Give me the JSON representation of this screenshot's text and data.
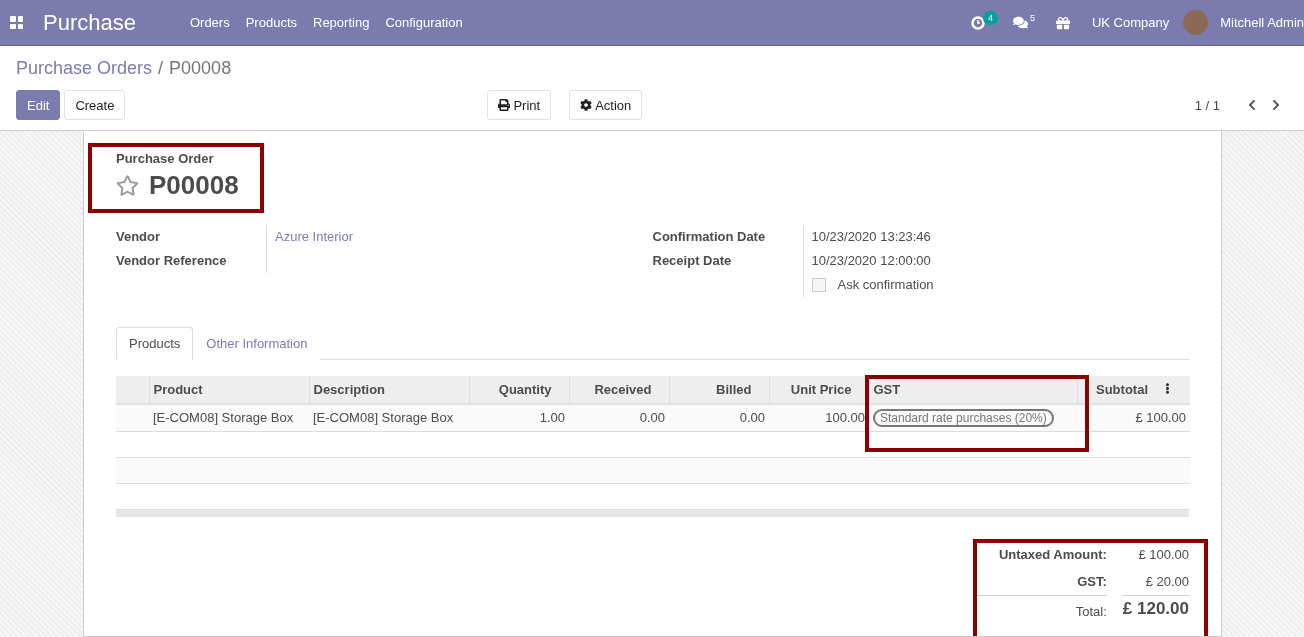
{
  "navbar": {
    "app_title": "Purchase",
    "menu": [
      "Orders",
      "Products",
      "Reporting",
      "Configuration"
    ],
    "activity_count": "4",
    "message_count": "5",
    "company": "UK Company",
    "user": "Mitchell Admin"
  },
  "breadcrumb": {
    "parent": "Purchase Orders",
    "separator": "/",
    "current": "P00008"
  },
  "buttons": [
    {
      "label": "Edit",
      "kind": "primary"
    },
    {
      "label": "Create",
      "kind": "secondary"
    }
  ],
  "actions": [
    {
      "label": "Print",
      "kind": "print"
    },
    {
      "label": "Action",
      "kind": "gear"
    }
  ],
  "pager": "1 / 1",
  "form": {
    "caption": "Purchase Order",
    "name": "P00008",
    "starred": false,
    "left_fields": [
      {
        "label": "Vendor",
        "value": "Azure Interior",
        "kind": "link"
      },
      {
        "label": "Vendor Reference"
      }
    ],
    "right_fields": [
      {
        "label": "Confirmation Date",
        "value": "10/23/2020 13:23:46"
      },
      {
        "label": "Receipt Date",
        "value": "10/23/2020 12:00:00"
      }
    ],
    "ask_confirmation": {
      "label": "Ask confirmation",
      "checked": false
    }
  },
  "tabs": [
    {
      "label": "Products",
      "selected": true
    },
    {
      "label": "Other Information",
      "selected": false
    }
  ],
  "table": {
    "columns": [
      {
        "label": "Product",
        "kind": "text"
      },
      {
        "label": "Description",
        "kind": "text"
      },
      {
        "label": "Quantity",
        "kind": "number"
      },
      {
        "label": "Received",
        "kind": "number"
      },
      {
        "label": "Billed",
        "kind": "number"
      },
      {
        "label": "Unit Price",
        "kind": "number"
      },
      {
        "label": "GST",
        "kind": "tag"
      },
      {
        "label": "Subtotal",
        "kind": "number"
      }
    ],
    "rows": [
      {
        "cells": [
          "[E-COM08] Storage Box",
          "[E-COM08] Storage Box",
          "1.00",
          "0.00",
          "0.00",
          "100.00",
          "Standard rate purchases (20%)",
          "£ 100.00"
        ]
      }
    ]
  },
  "totals": [
    {
      "label": "Untaxed Amount:",
      "value": "£ 100.00",
      "kind": "sub"
    },
    {
      "label": "GST:",
      "value": "£ 20.00",
      "kind": "sub"
    },
    {
      "label": "Total:",
      "value": "£ 120.00",
      "kind": "total"
    }
  ]
}
